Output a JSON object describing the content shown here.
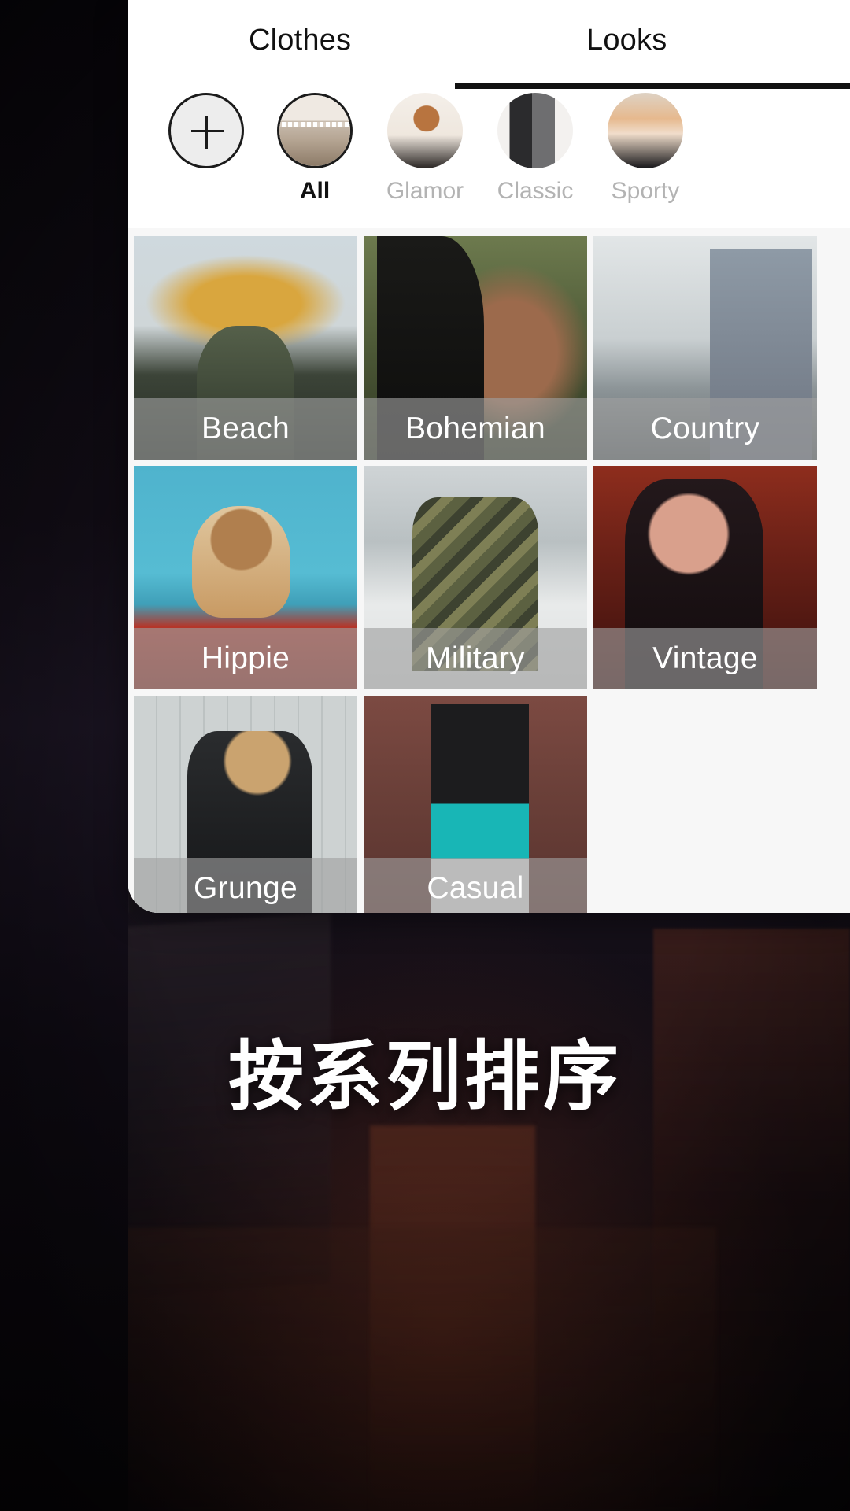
{
  "tabs": [
    {
      "label": "Clothes",
      "active": false
    },
    {
      "label": "Looks",
      "active": true
    }
  ],
  "categories": [
    {
      "label": "",
      "icon": "plus-icon",
      "type": "add",
      "active": false
    },
    {
      "label": "All",
      "icon": "clothes-rack-thumb",
      "type": "thumb",
      "active": true
    },
    {
      "label": "Glamor",
      "icon": "glamor-thumb",
      "type": "thumb",
      "active": false
    },
    {
      "label": "Classic",
      "icon": "classic-thumb",
      "type": "thumb",
      "active": false
    },
    {
      "label": "Sporty",
      "icon": "sporty-thumb",
      "type": "thumb",
      "active": false
    }
  ],
  "looks": [
    {
      "label": "Beach"
    },
    {
      "label": "Bohemian"
    },
    {
      "label": "Country"
    },
    {
      "label": "Hippie"
    },
    {
      "label": "Military"
    },
    {
      "label": "Vintage"
    },
    {
      "label": "Grunge"
    },
    {
      "label": "Casual"
    }
  ],
  "tagline": "按系列排序",
  "colors": {
    "panel_background": "#ffffff",
    "grid_background": "#f7f7f7",
    "active_text": "#111111",
    "inactive_text": "#b3b3b3",
    "tab_indicator": "#111111",
    "caption_overlay": "rgba(160,160,160,0.62)",
    "caption_text": "#ffffff",
    "tagline_text": "#ffffff",
    "backdrop": "#100c14"
  }
}
